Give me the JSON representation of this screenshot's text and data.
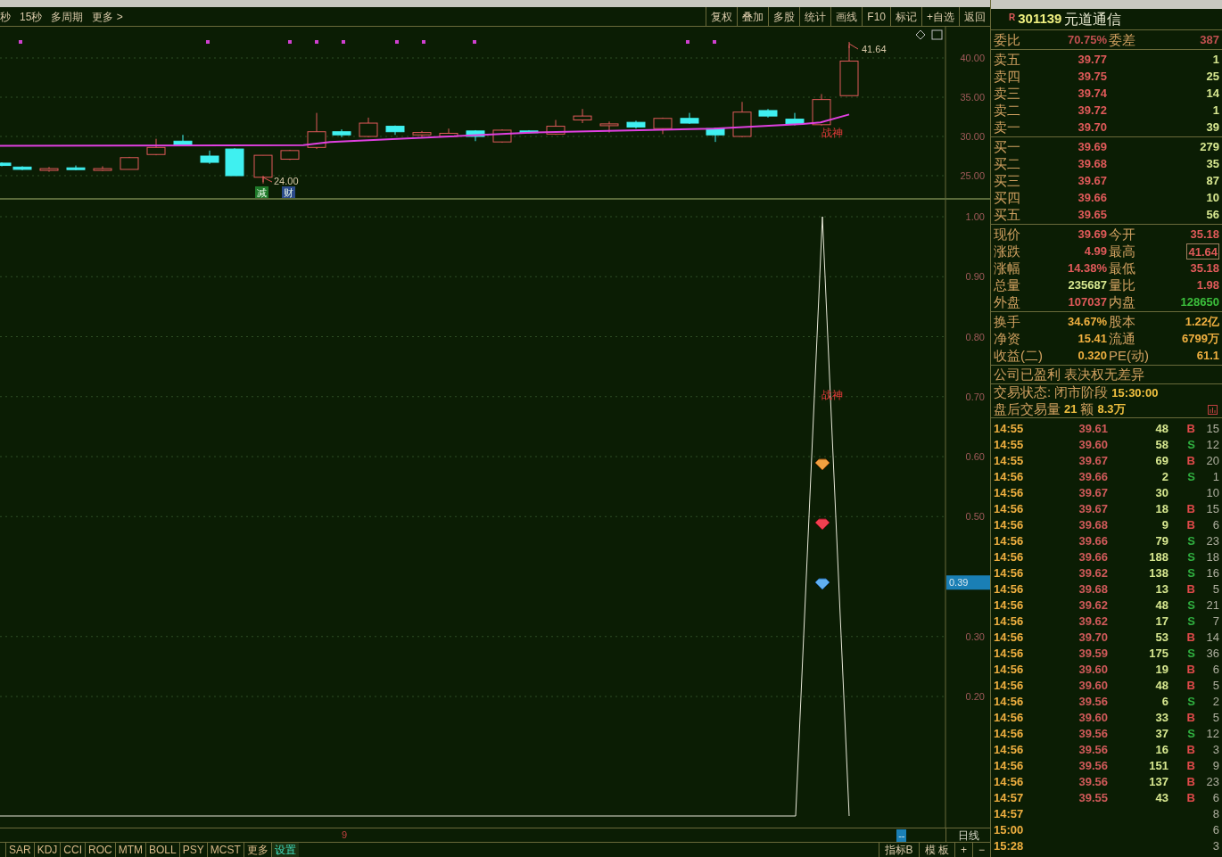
{
  "toolbar": {
    "left": [
      "秒",
      "15秒",
      "多周期",
      "更多 >"
    ],
    "right": [
      "复权",
      "叠加",
      "多股",
      "统计",
      "画线",
      "F10",
      "标记",
      "+自选",
      "返回"
    ]
  },
  "price_chart": {
    "axis_labels": [
      "40.00",
      "35.00",
      "30.00",
      "25.00"
    ],
    "high_label": "41.64",
    "low_label": "24.00",
    "signal_label": "战神",
    "markers": [
      {
        "text": "减",
        "color": "#1f7a2a"
      },
      {
        "text": "财",
        "color": "#2a4a8a"
      }
    ]
  },
  "indicator_chart": {
    "axis_labels": [
      "1.00",
      "0.90",
      "0.80",
      "0.70",
      "0.60",
      "0.50",
      "0.30",
      "0.20"
    ],
    "current_value": "0.39",
    "signal_label": "战神"
  },
  "x_axis": {
    "marker": "9",
    "badge": "--",
    "period": "日线"
  },
  "indicator_tabs": [
    {
      "label": "SAR",
      "selected": false
    },
    {
      "label": "KDJ",
      "selected": false
    },
    {
      "label": "CCI",
      "selected": false
    },
    {
      "label": "ROC",
      "selected": false
    },
    {
      "label": "MTM",
      "selected": false
    },
    {
      "label": "BOLL",
      "selected": false
    },
    {
      "label": "PSY",
      "selected": false
    },
    {
      "label": "MCST",
      "selected": false
    },
    {
      "label": "更多",
      "selected": false
    },
    {
      "label": "设置",
      "selected": true
    }
  ],
  "bottom_right": [
    "指标B",
    "模 板",
    "+",
    "−"
  ],
  "quote": {
    "stock": {
      "flag": "R",
      "code": "301139",
      "name": "元道通信"
    },
    "order_ratio": {
      "label": "委比",
      "value": "70.75%",
      "label2": "委差",
      "value2": "387"
    },
    "asks": [
      {
        "label": "卖五",
        "price": "39.77",
        "volume": "1"
      },
      {
        "label": "卖四",
        "price": "39.75",
        "volume": "25"
      },
      {
        "label": "卖三",
        "price": "39.74",
        "volume": "14"
      },
      {
        "label": "卖二",
        "price": "39.72",
        "volume": "1"
      },
      {
        "label": "卖一",
        "price": "39.70",
        "volume": "39"
      }
    ],
    "bids": [
      {
        "label": "买一",
        "price": "39.69",
        "volume": "279"
      },
      {
        "label": "买二",
        "price": "39.68",
        "volume": "35"
      },
      {
        "label": "买三",
        "price": "39.67",
        "volume": "87"
      },
      {
        "label": "买四",
        "price": "39.66",
        "volume": "10"
      },
      {
        "label": "买五",
        "price": "39.65",
        "volume": "56"
      }
    ],
    "stats": [
      {
        "left": {
          "label": "现价",
          "value": "39.69",
          "color": "#e05a5a"
        },
        "right": {
          "label": "今开",
          "value": "35.18",
          "color": "#e05a5a",
          "boxed": false
        }
      },
      {
        "left": {
          "label": "涨跌",
          "value": "4.99",
          "color": "#e05a5a"
        },
        "right": {
          "label": "最高",
          "value": "41.64",
          "color": "#e05a5a",
          "boxed": true
        }
      },
      {
        "left": {
          "label": "涨幅",
          "value": "14.38%",
          "color": "#e05a5a"
        },
        "right": {
          "label": "最低",
          "value": "35.18",
          "color": "#e05a5a",
          "boxed": false
        }
      },
      {
        "left": {
          "label": "总量",
          "value": "235687",
          "color": "#d8e890"
        },
        "right": {
          "label": "量比",
          "value": "1.98",
          "color": "#e05a5a",
          "boxed": false
        }
      },
      {
        "left": {
          "label": "外盘",
          "value": "107037",
          "color": "#e05a5a"
        },
        "right": {
          "label": "内盘",
          "value": "128650",
          "color": "#3cc03c",
          "boxed": false
        }
      }
    ],
    "fundamentals": [
      {
        "label": "换手",
        "value": "34.67%",
        "label2": "股本",
        "value2": "1.22亿"
      },
      {
        "label": "净资",
        "value": "15.41",
        "label2": "流通",
        "value2": "6799万"
      },
      {
        "label": "收益(二)",
        "value": "0.320",
        "label2": "PE(动)",
        "value2": "61.1"
      }
    ],
    "notice": "公司已盈利 表决权无差异",
    "status": {
      "label": "交易状态: 闭市阶段",
      "time": "15:30:00"
    },
    "after_hours": {
      "label": "盘后交易量",
      "volume": "21",
      "amount_label": "额",
      "amount": "8.3万"
    }
  },
  "trades": [
    {
      "time": "14:55",
      "price": "39.61",
      "volume": "48",
      "side": "B",
      "count": "15"
    },
    {
      "time": "14:55",
      "price": "39.60",
      "volume": "58",
      "side": "S",
      "count": "12"
    },
    {
      "time": "14:55",
      "price": "39.67",
      "volume": "69",
      "side": "B",
      "count": "20"
    },
    {
      "time": "14:56",
      "price": "39.66",
      "volume": "2",
      "side": "S",
      "count": "1"
    },
    {
      "time": "14:56",
      "price": "39.67",
      "volume": "30",
      "count": "10"
    },
    {
      "time": "14:56",
      "price": "39.67",
      "volume": "18",
      "side": "B",
      "count": "15"
    },
    {
      "time": "14:56",
      "price": "39.68",
      "volume": "9",
      "side": "B",
      "count": "6"
    },
    {
      "time": "14:56",
      "price": "39.66",
      "volume": "79",
      "side": "S",
      "count": "23"
    },
    {
      "time": "14:56",
      "price": "39.66",
      "volume": "188",
      "side": "S",
      "count": "18"
    },
    {
      "time": "14:56",
      "price": "39.62",
      "volume": "138",
      "side": "S",
      "count": "16"
    },
    {
      "time": "14:56",
      "price": "39.68",
      "volume": "13",
      "side": "B",
      "count": "5"
    },
    {
      "time": "14:56",
      "price": "39.62",
      "volume": "48",
      "side": "S",
      "count": "21"
    },
    {
      "time": "14:56",
      "price": "39.62",
      "volume": "17",
      "side": "S",
      "count": "7"
    },
    {
      "time": "14:56",
      "price": "39.70",
      "volume": "53",
      "side": "B",
      "count": "14"
    },
    {
      "time": "14:56",
      "price": "39.59",
      "volume": "175",
      "side": "S",
      "count": "36"
    },
    {
      "time": "14:56",
      "price": "39.60",
      "volume": "19",
      "side": "B",
      "count": "6"
    },
    {
      "time": "14:56",
      "price": "39.60",
      "volume": "48",
      "side": "B",
      "count": "5"
    },
    {
      "time": "14:56",
      "price": "39.56",
      "volume": "6",
      "side": "S",
      "count": "2"
    },
    {
      "time": "14:56",
      "price": "39.60",
      "volume": "33",
      "side": "B",
      "count": "5"
    },
    {
      "time": "14:56",
      "price": "39.56",
      "volume": "37",
      "side": "S",
      "count": "12"
    },
    {
      "time": "14:56",
      "price": "39.56",
      "volume": "16",
      "side": "B",
      "count": "3"
    },
    {
      "time": "14:56",
      "price": "39.56",
      "volume": "151",
      "side": "B",
      "count": "9"
    },
    {
      "time": "14:56",
      "price": "39.56",
      "volume": "137",
      "side": "B",
      "count": "23"
    },
    {
      "time": "14:57",
      "price": "39.55",
      "volume": "43",
      "side": "B",
      "count": "6"
    },
    {
      "time": "14:57",
      "count": "8"
    },
    {
      "time": "15:00",
      "count": "6"
    },
    {
      "time": "15:28",
      "count": "3"
    }
  ]
}
